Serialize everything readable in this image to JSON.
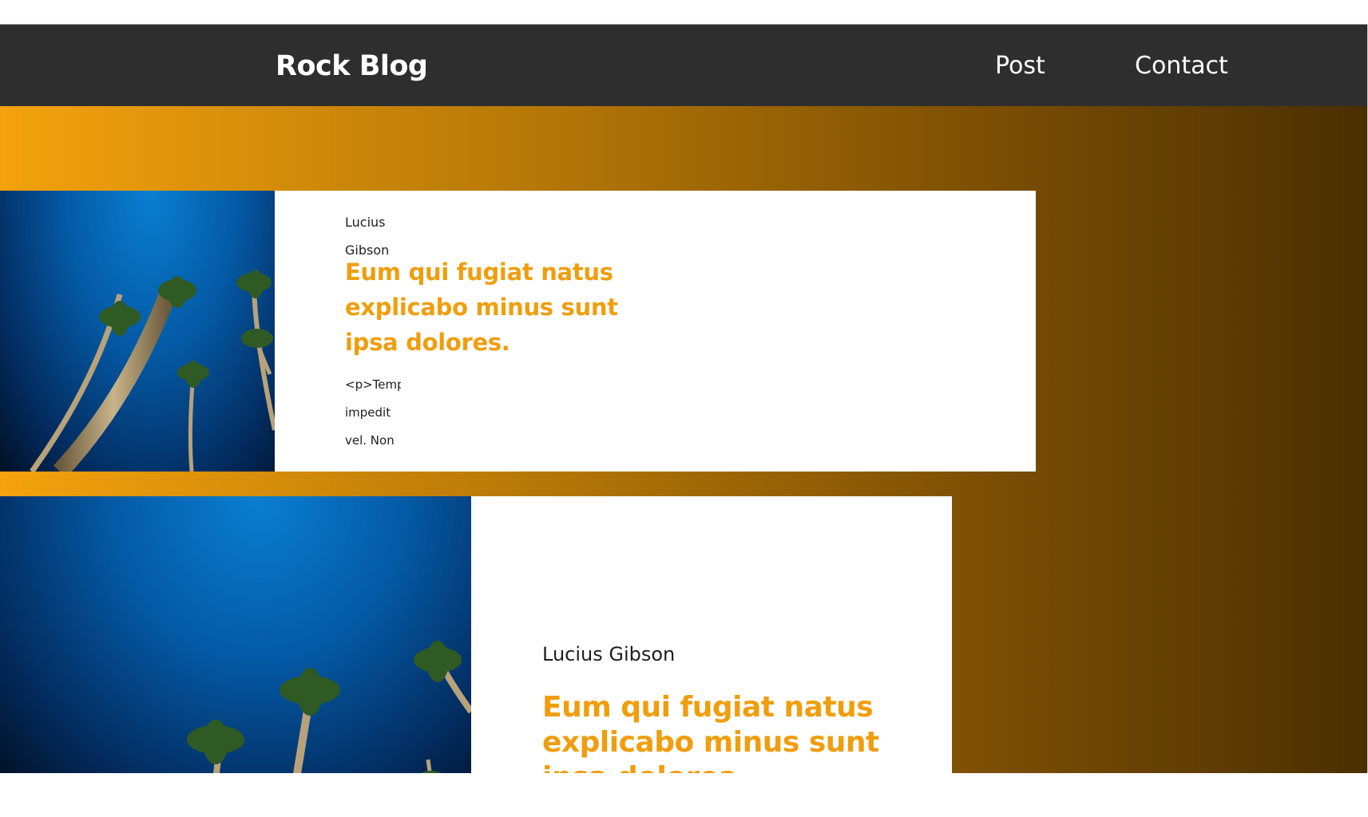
{
  "navbar": {
    "brand": "Rock Blog",
    "links": [
      {
        "label": "Post"
      },
      {
        "label": "Contact"
      }
    ]
  },
  "posts": [
    {
      "author_line1": "Lucius",
      "author_line2": "Gibson",
      "title": "Eum qui fugiat natus explicabo minus sunt ipsa dolores.",
      "excerpt_lines": [
        "<p>Temp",
        "impedit",
        "vel. Non"
      ],
      "image": "palm-trees-photo"
    },
    {
      "author": "Lucius Gibson",
      "title": "Eum qui fugiat natus explicabo minus sunt ipsa dolores.",
      "image": "palm-trees-photo"
    }
  ],
  "colors": {
    "navbar_bg": "#2e2e2e",
    "accent": "#f09e0e",
    "gradient_start": "#f4a20d",
    "gradient_end": "#4a2f02"
  }
}
